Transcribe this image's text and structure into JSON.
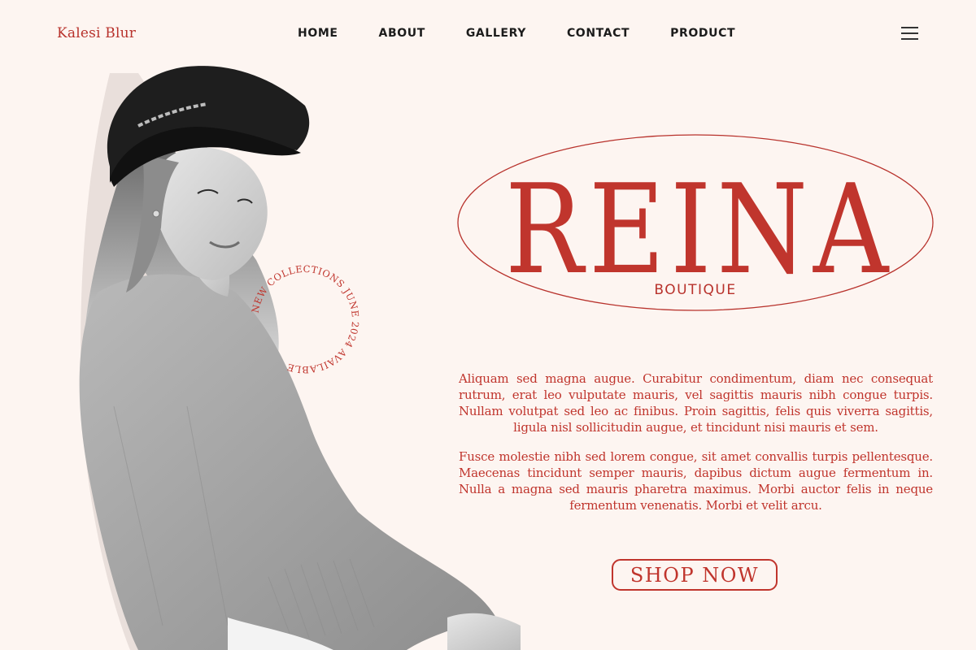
{
  "header": {
    "brand": "Kalesi Blur",
    "nav": [
      {
        "label": "HOME"
      },
      {
        "label": "ABOUT"
      },
      {
        "label": "GALLERY"
      },
      {
        "label": "CONTACT"
      },
      {
        "label": "PRODUCT"
      }
    ],
    "menu_icon": "hamburger-menu-icon"
  },
  "hero": {
    "circle_text": "NEW COLLECTIONS JUNE 2024 AVAILABLE",
    "logo_title": "REINA",
    "logo_subtitle": "BOUTIQUE",
    "paragraphs": [
      "Aliquam sed magna augue. Curabitur condimentum, diam nec consequat rutrum, erat leo vulputate mauris, vel sagittis mauris nibh congue turpis. Nullam volutpat sed leo ac finibus. Proin sagittis, felis quis viverra sagittis, ligula nisl sollicitudin augue, et tincidunt nisi mauris et sem.",
      "Fusce molestie nibh sed lorem congue, sit amet convallis turpis pellentesque. Maecenas tincidunt semper mauris, dapibus dictum augue fermentum in. Nulla a magna sed mauris pharetra maximus. Morbi auctor felis in neque fermentum venenatis. Morbi et velit arcu."
    ],
    "cta_label": "SHOP NOW"
  },
  "colors": {
    "background": "#fdf5f1",
    "accent": "#c0352d",
    "text_dark": "#1c1c1c"
  }
}
